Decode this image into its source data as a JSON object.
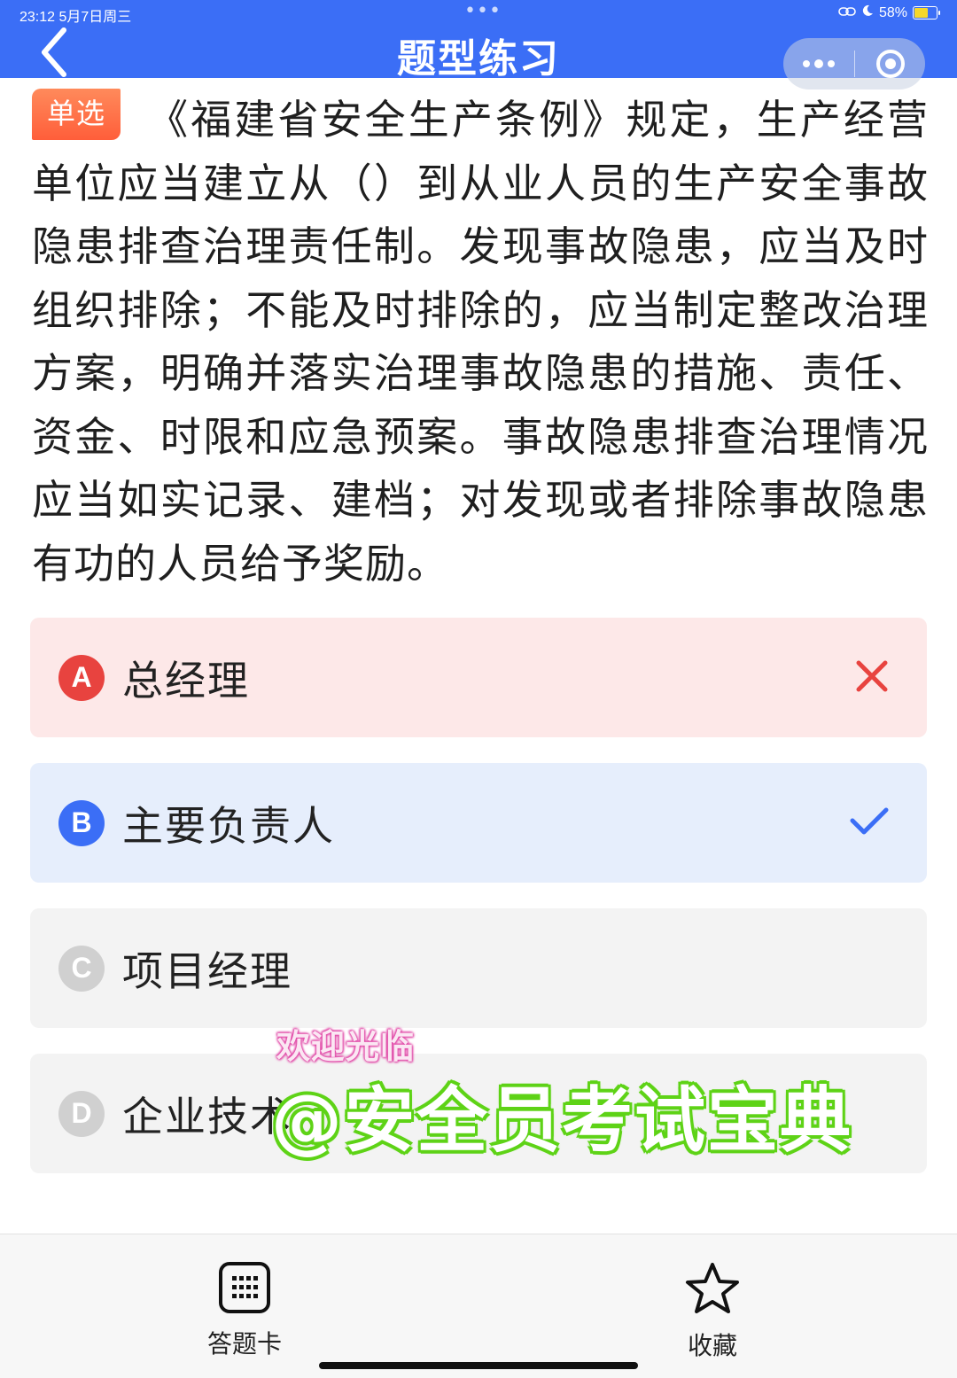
{
  "status_bar": {
    "time_date": "23:12  5月7日周三",
    "dots": "•••",
    "battery_percent": "58%",
    "battery_level": 0.58,
    "icons": [
      "link-icon",
      "moon-icon",
      "battery-charging-icon"
    ]
  },
  "header": {
    "title": "题型练习",
    "background": "#3b6ef6",
    "back_icon": "chevron-left-icon",
    "more_icon": "more-dots-icon",
    "target_icon": "target-icon"
  },
  "question": {
    "type_label": "单选",
    "text": "《福建省安全生产条例》规定，生产经营单位应当建立从（）到从业人员的生产安全事故隐患排查治理责任制。发现事故隐患，应当及时组织排除；不能及时排除的，应当制定整改治理方案，明确并落实治理事故隐患的措施、责任、资金、时限和应急预案。事故隐患排查治理情况应当如实记录、建档；对发现或者排除事故隐患有功的人员给予奖励。"
  },
  "options": [
    {
      "letter": "A",
      "text": "总经理",
      "state": "wrong",
      "mark_icon": "cross-icon",
      "color": "#e8433f"
    },
    {
      "letter": "B",
      "text": "主要负责人",
      "state": "correct",
      "mark_icon": "check-icon",
      "color": "#3b6ef6"
    },
    {
      "letter": "C",
      "text": "项目经理",
      "state": "neutral"
    },
    {
      "letter": "D",
      "text": "企业技术",
      "state": "neutral"
    }
  ],
  "watermark": {
    "line1": "欢迎光临",
    "line2": "@安全员考试宝典"
  },
  "bottom_bar": {
    "answer_card_label": "答题卡",
    "answer_card_icon": "grid-icon",
    "favorite_label": "收藏",
    "favorite_icon": "star-icon"
  }
}
